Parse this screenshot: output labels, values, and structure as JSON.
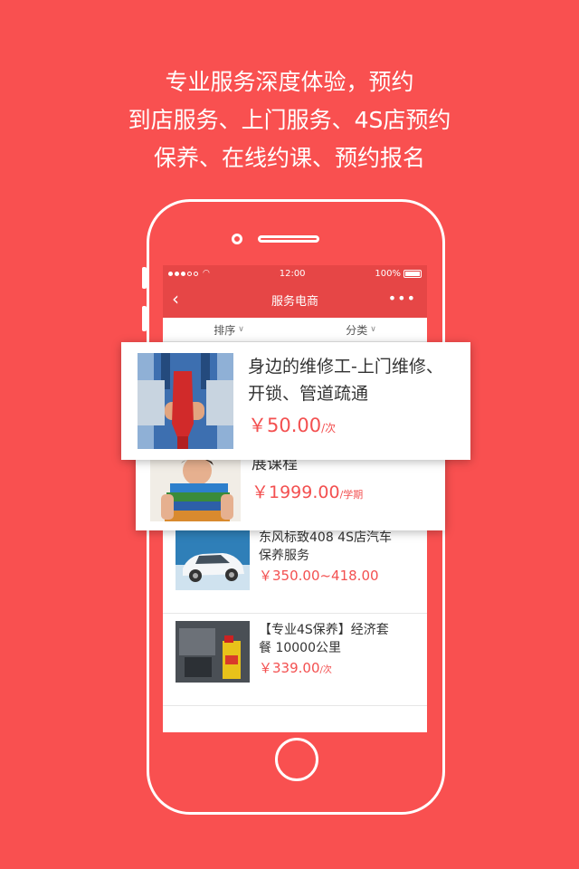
{
  "headline": {
    "line1": "专业服务深度体验，预约",
    "line2": "到店服务、上门服务、4S店预约",
    "line3": "保养、在线约课、预约报名"
  },
  "status_bar": {
    "time": "12:00",
    "battery": "100%"
  },
  "nav": {
    "back_icon": "‹",
    "title": "服务电商",
    "more_icon": "•••"
  },
  "filters": [
    {
      "label": "排序",
      "chevron": "∨"
    },
    {
      "label": "分类",
      "chevron": "∨"
    }
  ],
  "cards": [
    {
      "title_line1": "身边的维修工-上门维修、",
      "title_line2": "开锁、管道疏通",
      "price": "￥50.00",
      "unit": "/次"
    },
    {
      "title_partial": "展课程",
      "price": "￥1999.00",
      "unit": "/学期"
    }
  ],
  "items": [
    {
      "title_line1": "东风标致408  4S店汽车",
      "title_line2": "保养服务",
      "price": "￥350.00~418.00",
      "unit": ""
    },
    {
      "title_line1": "【专业4S保养】经济套",
      "title_line2": "餐 10000公里",
      "price": "￥339.00",
      "unit": "/次"
    }
  ],
  "colors": {
    "background": "#f95050",
    "nav": "#e64646",
    "price": "#f35050"
  }
}
